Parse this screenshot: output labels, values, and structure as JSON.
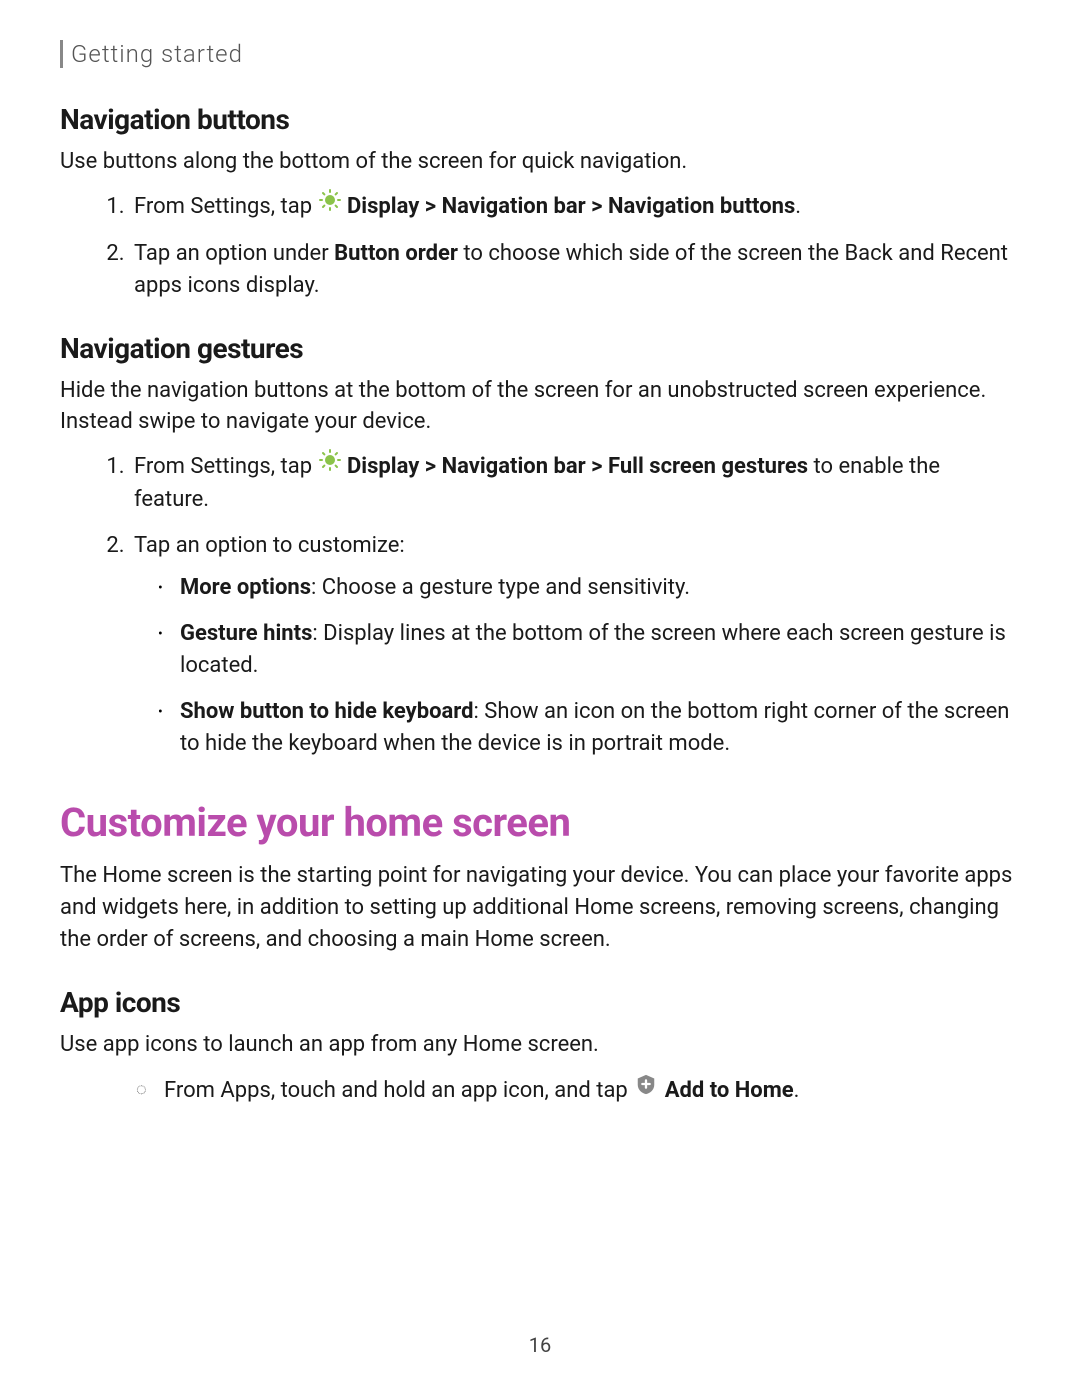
{
  "breadcrumb": "Getting started",
  "sec1": {
    "title": "Navigation buttons",
    "intro": "Use buttons along the bottom of the screen for quick navigation.",
    "step1_pre": "From Settings, tap ",
    "step1_bold": "Display > Navigation bar > Navigation buttons",
    "step1_post": ".",
    "step2_pre": "Tap an option under ",
    "step2_bold": "Button order",
    "step2_post": " to choose which side of the screen the Back and Recent apps icons display."
  },
  "sec2": {
    "title": "Navigation gestures",
    "intro": "Hide the navigation buttons at the bottom of the screen for an unobstructed screen experience. Instead swipe to navigate your device.",
    "step1_pre": "From Settings, tap ",
    "step1_bold": "Display > Navigation bar > Full screen gestures",
    "step1_post": " to enable the feature.",
    "step2": "Tap an option to customize:",
    "opt1_bold": "More options",
    "opt1_rest": ": Choose a gesture type and sensitivity.",
    "opt2_bold": "Gesture hints",
    "opt2_rest": ": Display lines at the bottom of the screen where each screen gesture is located.",
    "opt3_bold": "Show button to hide keyboard",
    "opt3_rest": ": Show an icon on the bottom right corner of the screen to hide the keyboard when the device is in portrait mode."
  },
  "mainTitle": "Customize your home screen",
  "mainIntro": "The Home screen is the starting point for navigating your device. You can place your favorite apps and widgets here, in addition to setting up additional Home screens, removing screens, changing the order of screens, and choosing a main Home screen.",
  "sec3": {
    "title": "App icons",
    "intro": "Use app icons to launch an app from any Home screen.",
    "step_pre": "From Apps, touch and hold an app icon, and tap ",
    "step_bold": "Add to Home",
    "step_post": "."
  },
  "pageNumber": "16"
}
